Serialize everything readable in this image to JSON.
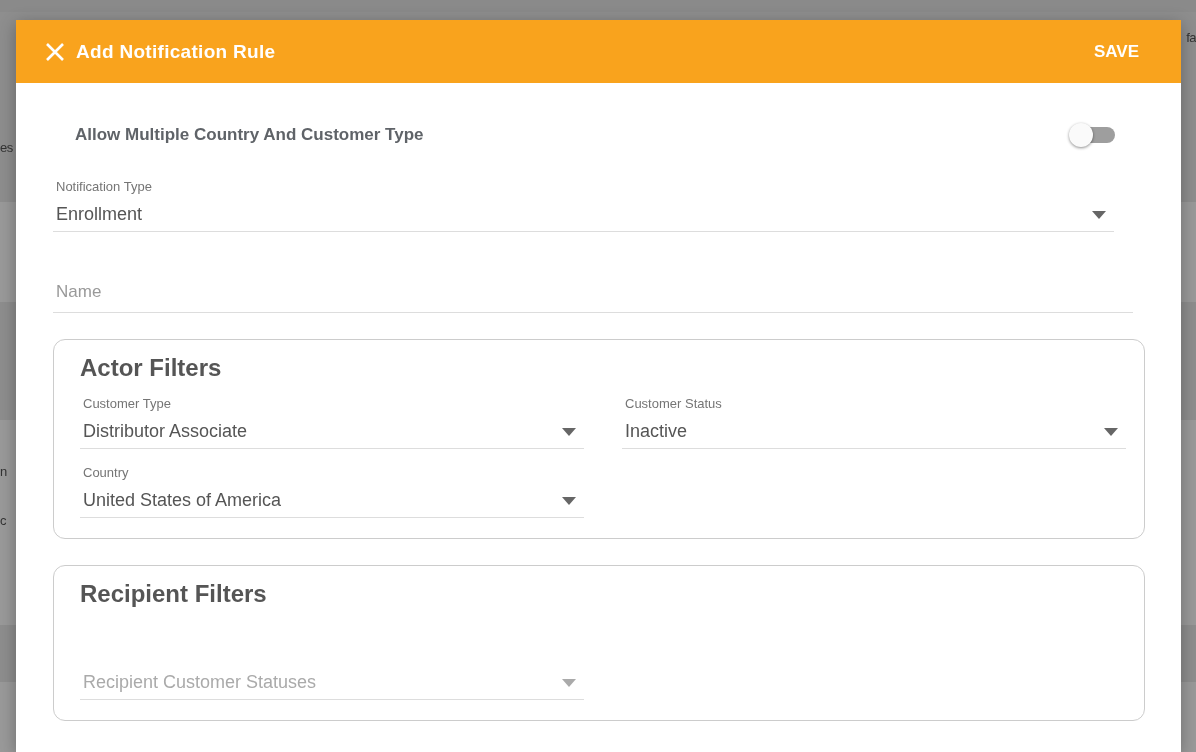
{
  "background_fragments": {
    "left": [
      "es",
      "n",
      "c"
    ],
    "right": [
      "fa"
    ]
  },
  "dialog": {
    "title": "Add Notification Rule",
    "save_label": "SAVE",
    "toggle": {
      "label": "Allow Multiple Country And Customer Type",
      "on": false
    },
    "notification_type": {
      "label": "Notification Type",
      "value": "Enrollment"
    },
    "name": {
      "placeholder": "Name"
    },
    "sections": [
      {
        "title": "Actor Filters",
        "fields": [
          {
            "label": "Customer Type",
            "value": "Distributor Associate"
          },
          {
            "label": "Customer Status",
            "value": "Inactive"
          },
          {
            "label": "Country",
            "value": "United States of America"
          }
        ]
      },
      {
        "title": "Recipient Filters",
        "fields": [
          {
            "placeholder": "Recipient Customer Statuses"
          }
        ]
      }
    ]
  }
}
